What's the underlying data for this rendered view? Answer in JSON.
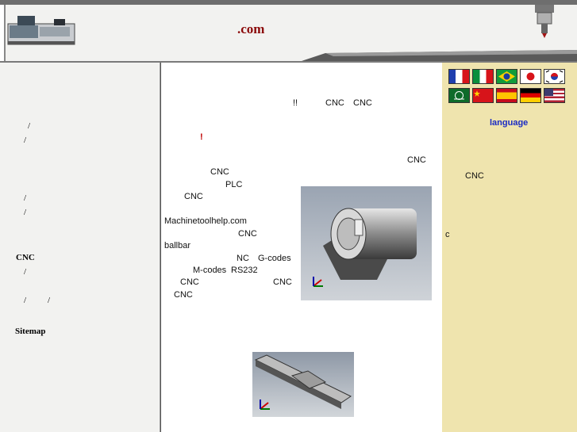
{
  "header": {
    "title": ".com"
  },
  "left_nav": {
    "items": [
      {
        "label": "/"
      },
      {
        "label": "/"
      },
      {
        "label": "/"
      },
      {
        "label": "/"
      },
      {
        "label": "CNC"
      },
      {
        "label": "/"
      },
      {
        "label": "/"
      },
      {
        "label": "/"
      },
      {
        "label": "Sitemap"
      }
    ]
  },
  "main": {
    "line1_exclaim": "!!",
    "line1_cnc1": "CNC",
    "line1_cnc2": "CNC",
    "highlight": "!",
    "p_cnc_a": "CNC",
    "p_cnc_b": "CNC",
    "p_plc": "PLC",
    "p_cnc_c": "CNC",
    "p_site": "Machinetoolhelp.com",
    "p_cnc_d": "CNC",
    "p_ballbar": "ballbar",
    "p_nc": "NC",
    "p_gcodes": "G-codes",
    "p_mcodes": "M-codes",
    "p_rs232": "RS232",
    "p_cnc_e": "CNC",
    "p_cnc_f": "CNC",
    "p_cnc_g": "CNC"
  },
  "right": {
    "language_label": "language",
    "cnc": "CNC",
    "c": "c",
    "flags": [
      "france-flag",
      "italy-flag",
      "brazil-flag",
      "japan-flag",
      "korea-flag",
      "saudi-flag",
      "china-flag",
      "spain-flag",
      "germany-flag",
      "usa-flag"
    ]
  },
  "colors": {
    "right_bg": "#efe4ae",
    "title": "#8b0a0a",
    "link": "#1a2bc4"
  }
}
